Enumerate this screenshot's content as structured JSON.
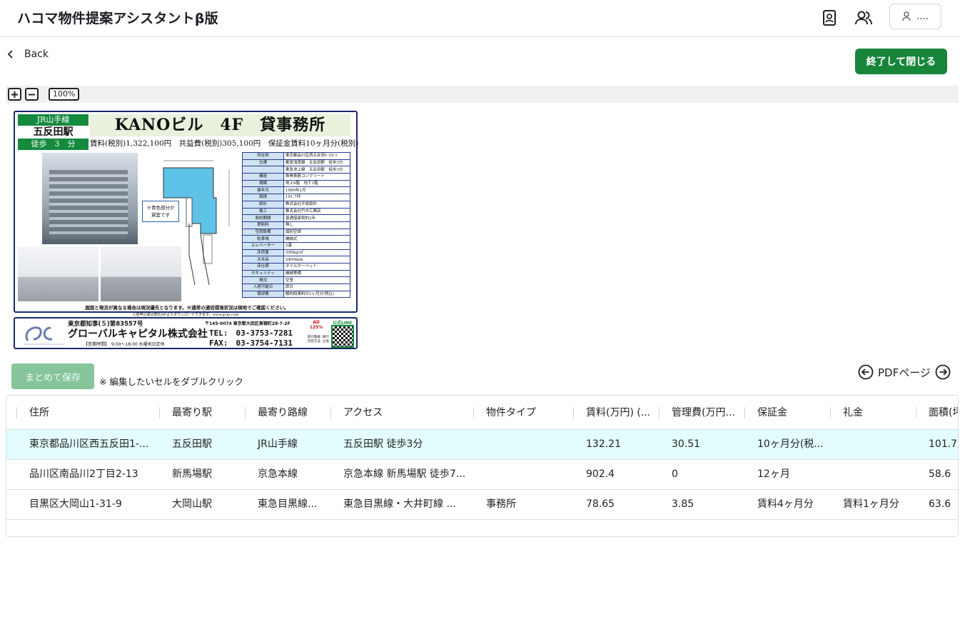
{
  "header": {
    "title": "ハコマ物件提案アシスタントβ版",
    "user_label": "...."
  },
  "nav": {
    "back_label": "Back",
    "close_label": "終了して閉じる"
  },
  "zoom": {
    "level": "100%"
  },
  "flyer": {
    "rail_line": "JR山手線",
    "station": "五反田駅",
    "walk": "徒歩　3　分",
    "title": "KANOビル　4F　貸事務所",
    "price_line": "賃料(税別)1,322,100円　共益費(税別)305,100円　保証金賃料10ヶ月分(税別)",
    "blue_note": "※青色部分が\n貸室です",
    "specs": [
      {
        "k": "所在地",
        "v": "東京都品川区西五反田1-25-1"
      },
      {
        "k": "交通",
        "v": "都営浅草線　五反田駅　徒歩3分"
      },
      {
        "k": "",
        "v": "東急池上線　五反田駅　徒歩3分"
      },
      {
        "k": "構造",
        "v": "鉄骨鉄筋コンクリート"
      },
      {
        "k": "規模",
        "v": "地上9階　地下1階"
      },
      {
        "k": "築年月",
        "v": "1989年1月"
      },
      {
        "k": "面積",
        "v": "101.7坪"
      },
      {
        "k": "設計",
        "v": "株式会社平成設計"
      },
      {
        "k": "施工",
        "v": "株式会社竹中工務店"
      },
      {
        "k": "契約期間",
        "v": "普通借家契約2年"
      },
      {
        "k": "更新料",
        "v": "無し"
      },
      {
        "k": "空調設備",
        "v": "個別空調"
      },
      {
        "k": "駐車場",
        "v": "機械式"
      },
      {
        "k": "エレベーター",
        "v": "2基"
      },
      {
        "k": "床荷重",
        "v": "300kg/㎡"
      },
      {
        "k": "天井高",
        "v": "2400mm"
      },
      {
        "k": "床仕様",
        "v": "タイルカーペット"
      },
      {
        "k": "セキュリティ",
        "v": "機械警備"
      },
      {
        "k": "現況",
        "v": "空室"
      },
      {
        "k": "入居可能日",
        "v": "即日"
      },
      {
        "k": "償却費",
        "v": "解約時賃料の1ヶ月分(税込)"
      }
    ],
    "notice": "図面と現況が異なる場合は現況優先となります。※通常の通信環境状況は現地でご確認ください。",
    "notice2": "入居申込書は弊社HPよりダウンロードできます。www.gcip.com",
    "company": {
      "license": "東京都知事(５)第83557号",
      "name": "グローバルキャピタル株式会社",
      "hours": "【営業時間】　9:00～18:00 水曜祝日定休",
      "address": "〒145-0074 東京都大田区東嶺町28-7-2F",
      "tel": "TEL:　03-3753-7281",
      "fax": "FAX:　03-3754-7131",
      "ad": "AD\n125%",
      "ad_sub": "取引態様 :媒介\n内見方法 :立会",
      "qr_label": "公式LINE"
    }
  },
  "save": {
    "button_label": "まとめて保存",
    "hint": "※ 編集したいセルをダブルクリック"
  },
  "pdf_nav": {
    "label": "PDFページ"
  },
  "table": {
    "columns": [
      "住所",
      "最寄り駅",
      "最寄り路線",
      "アクセス",
      "物件タイプ",
      "賃料(万円) (...",
      "管理費(万円...",
      "保証金",
      "礼金",
      "面積(坪"
    ],
    "rows": [
      [
        "東京都品川区西五反田1-...",
        "五反田駅",
        "JR山手線",
        "五反田駅 徒歩3分",
        "",
        "132.21",
        "30.51",
        "10ヶ月分(税...",
        "",
        "101.7"
      ],
      [
        "品川区南品川2丁目2-13",
        "新馬場駅",
        "京急本線",
        "京急本線 新馬場駅 徒歩7...",
        "",
        "902.4",
        "0",
        "12ヶ月",
        "",
        "58.6"
      ],
      [
        "目黒区大岡山1-31-9",
        "大岡山駅",
        "東急目黒線...",
        "東急目黒線・大井町線 ...",
        "事務所",
        "78.65",
        "3.85",
        "賃料4ヶ月分",
        "賃料1ヶ月分",
        "63.6"
      ]
    ]
  },
  "colors": {
    "primary_green": "#17853a",
    "disabled_green": "#86c49c",
    "selected_row": "#e3fcfd",
    "flyer_green": "#148a3d",
    "flyer_navy": "#1c2a6b"
  }
}
